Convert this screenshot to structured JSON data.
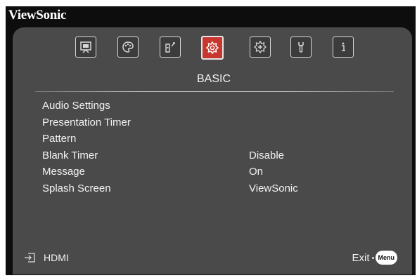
{
  "brand": "ViewSonic",
  "tabs": [
    {
      "icon": "display-icon"
    },
    {
      "icon": "image-palette-icon"
    },
    {
      "icon": "power-setting-icon"
    },
    {
      "icon": "basic-settings-icon",
      "active": true
    },
    {
      "icon": "advanced-settings-icon"
    },
    {
      "icon": "system-tool-icon"
    },
    {
      "icon": "information-icon"
    }
  ],
  "section_title": "BASIC",
  "menu_items": [
    {
      "label": "Audio Settings",
      "value": ""
    },
    {
      "label": "Presentation Timer",
      "value": ""
    },
    {
      "label": "Pattern",
      "value": ""
    },
    {
      "label": "Blank Timer",
      "value": "Disable"
    },
    {
      "label": "Message",
      "value": "On"
    },
    {
      "label": "Splash Screen",
      "value": "ViewSonic"
    }
  ],
  "footer": {
    "source_label": "HDMI",
    "exit_label": "Exit",
    "menu_button_label": "Menu"
  },
  "colors": {
    "panel": "#4a4a4a",
    "frame": "#0d0d0d",
    "active_tab": "#c8372d",
    "text": "#f2f2f2"
  }
}
